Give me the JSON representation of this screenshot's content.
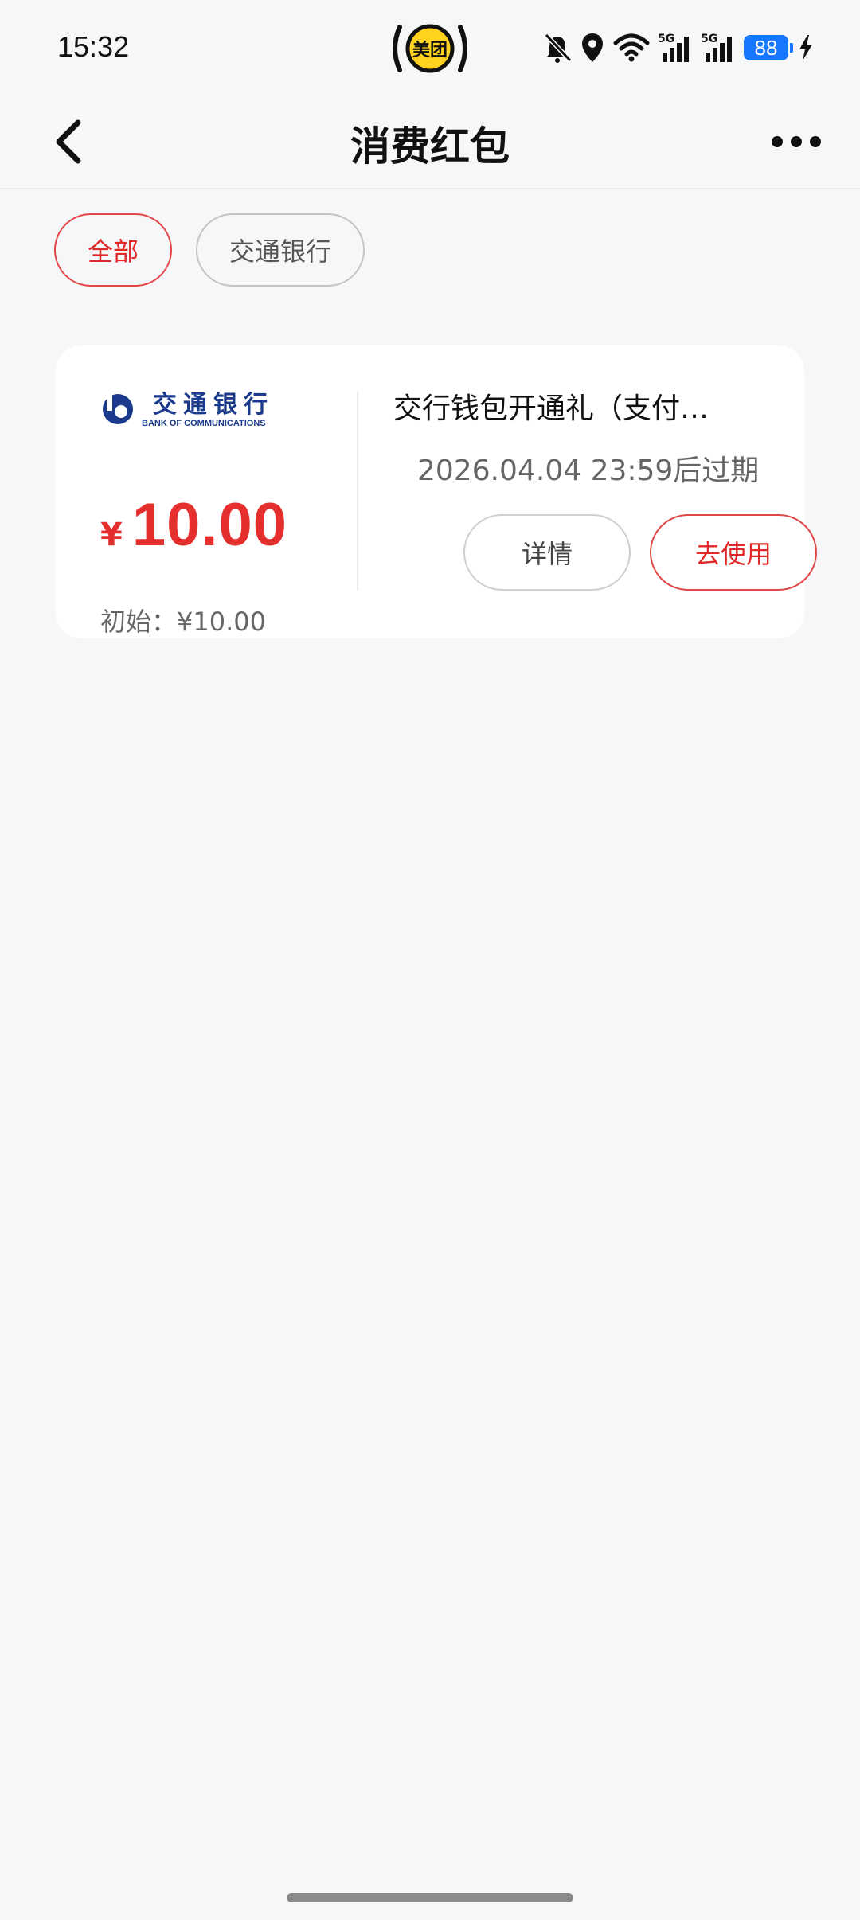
{
  "status_bar": {
    "time": "15:32",
    "app_badge": "美团",
    "battery": "88",
    "signal_label_1": "5G",
    "signal_label_2": "5G"
  },
  "nav": {
    "title": "消费红包"
  },
  "filters": [
    {
      "label": "全部",
      "active": true
    },
    {
      "label": "交通银行",
      "active": false
    }
  ],
  "coupon": {
    "bank_name_cn": "交通银行",
    "bank_name_en": "BANK OF COMMUNICATIONS",
    "currency": "¥",
    "amount": "10.00",
    "initial_label": "初始：¥10.00",
    "title": "交行钱包开通礼（支付…",
    "expiry": "2026.04.04 23:59后过期",
    "details_label": "详情",
    "use_label": "去使用"
  },
  "colors": {
    "accent": "#e02a2a",
    "background": "#f6f7f9",
    "bank_blue": "#1b3a8c",
    "battery": "#1677ff"
  }
}
